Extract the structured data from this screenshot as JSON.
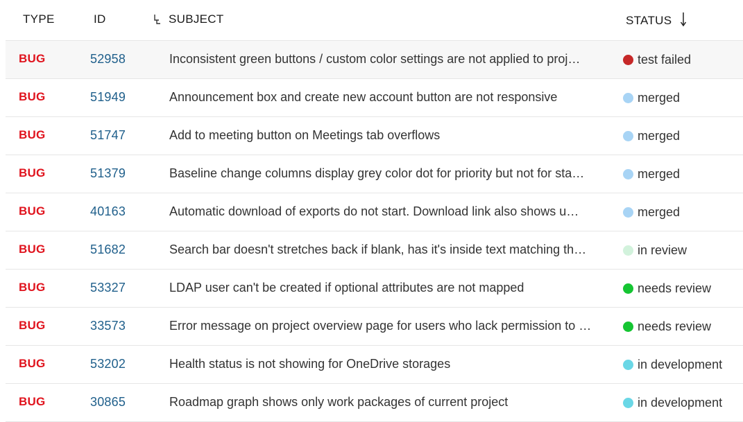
{
  "columns": {
    "type": "TYPE",
    "id": "ID",
    "subject": "SUBJECT",
    "status": "STATUS"
  },
  "status_colors": {
    "test failed": "#c62828",
    "merged": "#a8d4f5",
    "in review": "#d2f2dc",
    "needs review": "#15c532",
    "in development": "#6ad7e6"
  },
  "rows": [
    {
      "type": "BUG",
      "id": "52958",
      "subject": "Inconsistent green buttons / custom color settings are not applied to proj…",
      "status": "test failed",
      "color": "#c62828"
    },
    {
      "type": "BUG",
      "id": "51949",
      "subject": "Announcement box and create new account button are not responsive",
      "status": "merged",
      "color": "#a8d4f5"
    },
    {
      "type": "BUG",
      "id": "51747",
      "subject": "Add to meeting button on Meetings tab overflows",
      "status": "merged",
      "color": "#a8d4f5"
    },
    {
      "type": "BUG",
      "id": "51379",
      "subject": "Baseline change columns display grey color dot for priority but not for sta…",
      "status": "merged",
      "color": "#a8d4f5"
    },
    {
      "type": "BUG",
      "id": "40163",
      "subject": "Automatic download of exports do not start. Download link also shows u…",
      "status": "merged",
      "color": "#a8d4f5"
    },
    {
      "type": "BUG",
      "id": "51682",
      "subject": "Search bar doesn't stretches back if blank, has it's inside text matching th…",
      "status": "in review",
      "color": "#d2f2dc"
    },
    {
      "type": "BUG",
      "id": "53327",
      "subject": "LDAP user can't be created if optional attributes are not mapped",
      "status": "needs review",
      "color": "#15c532"
    },
    {
      "type": "BUG",
      "id": "33573",
      "subject": "Error message on project overview page for users who lack permission to …",
      "status": "needs review",
      "color": "#15c532"
    },
    {
      "type": "BUG",
      "id": "53202",
      "subject": "Health status is not showing for OneDrive storages",
      "status": "in development",
      "color": "#6ad7e6"
    },
    {
      "type": "BUG",
      "id": "30865",
      "subject": "Roadmap graph shows only work packages of current project",
      "status": "in development",
      "color": "#6ad7e6"
    }
  ]
}
